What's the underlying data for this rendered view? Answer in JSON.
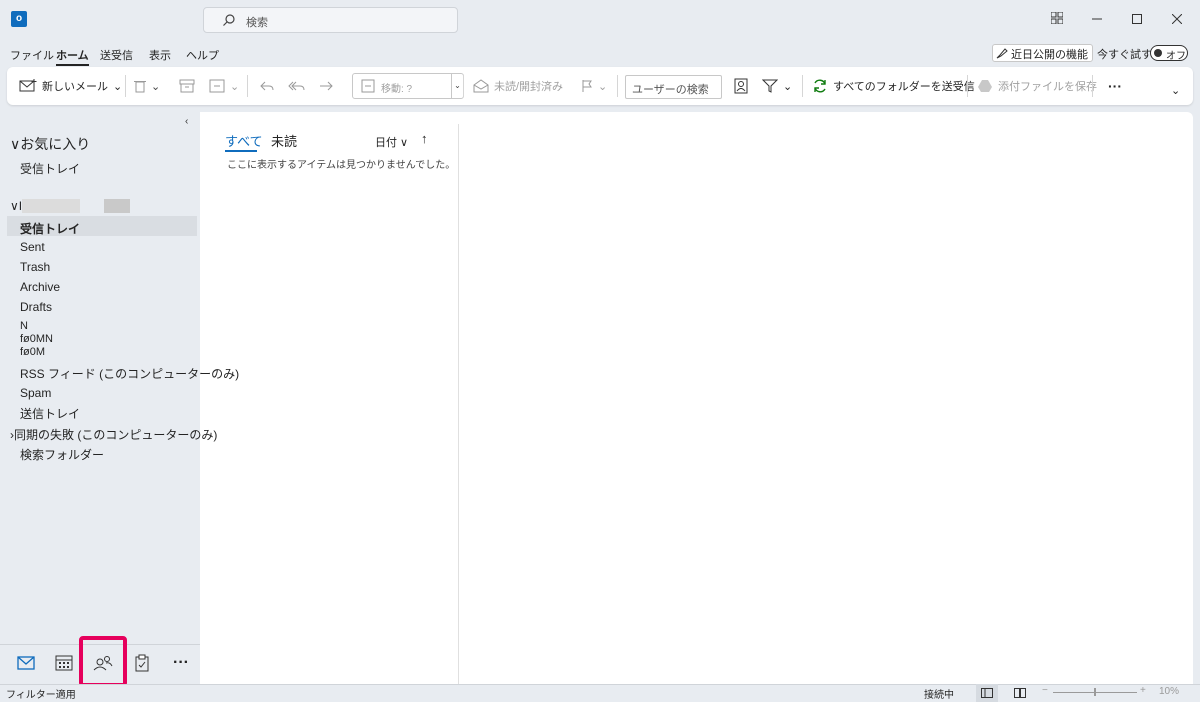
{
  "title_bar": {
    "app_icon": "outlook-logo",
    "app_icon_letter": "o",
    "search_placeholder": "検索",
    "window_controls": [
      "grid-icon",
      "minimize-icon",
      "maximize-icon",
      "close-icon"
    ]
  },
  "menu": {
    "items": [
      "ファイル",
      "ホーム",
      "送受信",
      "表示",
      "ヘルプ"
    ],
    "active": "ホーム",
    "coming_soon_label": "近日公開の機能",
    "try_now_label": "今すぐ試す",
    "toggle_label": "オフ"
  },
  "ribbon": {
    "new_mail": "新しいメール",
    "move_label": "移動: ?",
    "read_unread": "未読/開封済み",
    "people_search_placeholder": "ユーザーの検索",
    "send_receive_all": "すべてのフォルダーを送受信",
    "save_attachments": "添付ファイルを保存",
    "more": "···",
    "expand": "⌄"
  },
  "folder_pane": {
    "collapse_glyph": "‹",
    "favorites_header": "∨お気に入り",
    "favorites": [
      "受信トレイ"
    ],
    "account_header": "∨I",
    "folders": [
      {
        "label": "受信トレイ",
        "selected": true
      },
      {
        "label": "Sent"
      },
      {
        "label": "Trash"
      },
      {
        "label": "Archive"
      },
      {
        "label": "Drafts"
      },
      {
        "label": "N"
      },
      {
        "label": "fø0MN"
      },
      {
        "label": "fø0M"
      },
      {
        "label": "RSS フィード (このコンピューターのみ)"
      },
      {
        "label": "Spam"
      },
      {
        "label": "送信トレイ"
      },
      {
        "label": "›同期の失敗 (このコンピューターのみ)"
      },
      {
        "label": "検索フォルダー"
      }
    ]
  },
  "nav_bar": {
    "items": [
      "mail-icon",
      "calendar-icon",
      "people-icon",
      "tasks-icon",
      "more-icon"
    ],
    "more_glyph": "···",
    "highlighted": "people-icon",
    "highlight_color": "#e6005c"
  },
  "message_list": {
    "tabs": [
      "すべて",
      "未読"
    ],
    "active_tab": "すべて",
    "sort_label": "日付 ∨",
    "sort_direction": "↑",
    "empty_text": "ここに表示するアイテムは見つかりませんでした。"
  },
  "status_bar": {
    "left_text": "フィルター適用",
    "connection": "接続中",
    "zoom_minus": "−",
    "zoom_plus": "+",
    "zoom": "10%"
  },
  "colors": {
    "accent": "#0f6cbd",
    "chrome": "#e8ecf1",
    "highlight": "#e6005c"
  }
}
